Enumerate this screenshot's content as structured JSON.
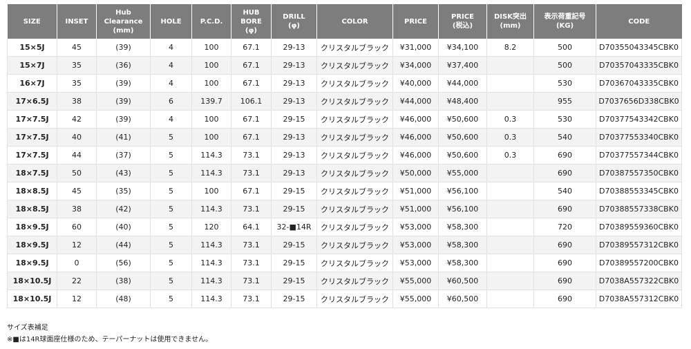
{
  "table": {
    "headers": [
      "SIZE",
      "INSET",
      "Hub\nClearance\n(mm)",
      "HOLE",
      "P.C.D.",
      "HUB\nBORE\n(φ)",
      "DRILL\n(φ)",
      "COLOR",
      "PRICE",
      "PRICE\n(税込)",
      "DISK突出\n(mm)",
      "表示荷重記号\n(KG)",
      "CODE"
    ],
    "rows": [
      [
        "15×5J",
        "45",
        "(39)",
        "4",
        "100",
        "67.1",
        "29-13",
        "クリスタルブラック",
        "¥31,000",
        "¥34,100",
        "8.2",
        "500",
        "D70355043345CBK0"
      ],
      [
        "15×7J",
        "35",
        "(36)",
        "4",
        "100",
        "67.1",
        "29-13",
        "クリスタルブラック",
        "¥34,000",
        "¥37,400",
        "",
        "500",
        "D70357043335CBK0"
      ],
      [
        "16×7J",
        "35",
        "(39)",
        "4",
        "100",
        "67.1",
        "29-13",
        "クリスタルブラック",
        "¥40,000",
        "¥44,000",
        "",
        "530",
        "D70367043335CBK0"
      ],
      [
        "17×6.5J",
        "38",
        "(39)",
        "6",
        "139.7",
        "106.1",
        "29-13",
        "クリスタルブラック",
        "¥44,000",
        "¥48,400",
        "",
        "955",
        "D7037656D338CBK0"
      ],
      [
        "17×7.5J",
        "42",
        "(39)",
        "4",
        "100",
        "67.1",
        "29-15",
        "クリスタルブラック",
        "¥46,000",
        "¥50,600",
        "0.3",
        "530",
        "D70377543342CBK0"
      ],
      [
        "17×7.5J",
        "40",
        "(41)",
        "5",
        "100",
        "67.1",
        "29-13",
        "クリスタルブラック",
        "¥46,000",
        "¥50,600",
        "0.3",
        "540",
        "D70377553340CBK0"
      ],
      [
        "17×7.5J",
        "44",
        "(37)",
        "5",
        "114.3",
        "73.1",
        "29-13",
        "クリスタルブラック",
        "¥46,000",
        "¥50,600",
        "0.3",
        "690",
        "D70377557344CBK0"
      ],
      [
        "18×7.5J",
        "50",
        "(43)",
        "5",
        "114.3",
        "73.1",
        "29-13",
        "クリスタルブラック",
        "¥50,000",
        "¥55,000",
        "",
        "690",
        "D70387557350CBK0"
      ],
      [
        "18×8.5J",
        "45",
        "(35)",
        "5",
        "100",
        "67.1",
        "29-15",
        "クリスタルブラック",
        "¥51,000",
        "¥56,100",
        "",
        "540",
        "D70388553345CBK0"
      ],
      [
        "18×8.5J",
        "38",
        "(42)",
        "5",
        "114.3",
        "73.1",
        "29-15",
        "クリスタルブラック",
        "¥51,000",
        "¥56,100",
        "",
        "690",
        "D70388557338CBK0"
      ],
      [
        "18×9.5J",
        "60",
        "(40)",
        "5",
        "120",
        "64.1",
        "32-■14R",
        "クリスタルブラック",
        "¥53,000",
        "¥58,300",
        "",
        "720",
        "D70389559360CBK0"
      ],
      [
        "18×9.5J",
        "12",
        "(44)",
        "5",
        "114.3",
        "73.1",
        "29-15",
        "クリスタルブラック",
        "¥53,000",
        "¥58,300",
        "",
        "690",
        "D70389557312CBK0"
      ],
      [
        "18×9.5J",
        "0",
        "(56)",
        "5",
        "114.3",
        "73.1",
        "29-15",
        "クリスタルブラック",
        "¥53,000",
        "¥58,300",
        "",
        "690",
        "D70389557200CBK0"
      ],
      [
        "18×10.5J",
        "22",
        "(38)",
        "5",
        "114.3",
        "73.1",
        "29-15",
        "クリスタルブラック",
        "¥55,000",
        "¥60,500",
        "",
        "690",
        "D7038A557322CBK0"
      ],
      [
        "18×10.5J",
        "12",
        "(48)",
        "5",
        "114.3",
        "73.1",
        "29-15",
        "クリスタルブラック",
        "¥55,000",
        "¥60,500",
        "",
        "690",
        "D7038A557312CBK0"
      ]
    ]
  },
  "notes": {
    "title": "サイズ表補足",
    "line1": "※■は14R球面座仕様のため、テーパーナットは使用できません。"
  }
}
